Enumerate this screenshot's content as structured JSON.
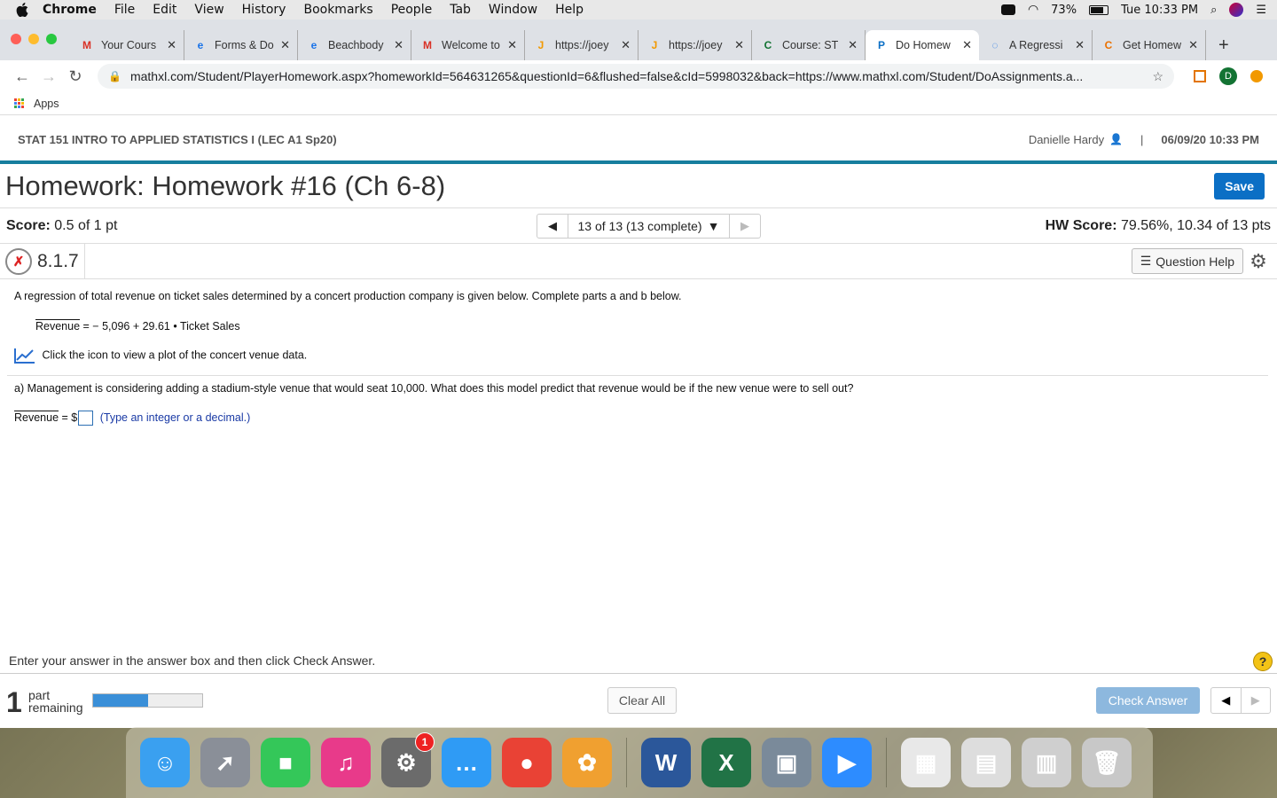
{
  "menubar": {
    "app": "Chrome",
    "items": [
      "File",
      "Edit",
      "View",
      "History",
      "Bookmarks",
      "People",
      "Tab",
      "Window",
      "Help"
    ],
    "battery": "73%",
    "clock": "Tue 10:33 PM"
  },
  "tabs": [
    {
      "title": "Your Cours",
      "icon": "gmail-icon",
      "color": "#d93025",
      "glyph": "M"
    },
    {
      "title": "Forms & Do",
      "icon": "edge-icon",
      "color": "#1a73e8",
      "glyph": "e"
    },
    {
      "title": "Beachbody",
      "icon": "edge-icon",
      "color": "#1a73e8",
      "glyph": "e"
    },
    {
      "title": "Welcome to",
      "icon": "gmail-icon",
      "color": "#d93025",
      "glyph": "M"
    },
    {
      "title": "https://joey",
      "icon": "joey-icon",
      "color": "#f29900",
      "glyph": "J"
    },
    {
      "title": "https://joey",
      "icon": "joey-icon",
      "color": "#f29900",
      "glyph": "J"
    },
    {
      "title": "Course: ST",
      "icon": "course-icon",
      "color": "#137333",
      "glyph": "C"
    },
    {
      "title": "Do Homew",
      "icon": "pearson-icon",
      "color": "#0b6fc5",
      "glyph": "P",
      "active": true
    },
    {
      "title": "A Regressi",
      "icon": "loading-icon",
      "color": "#1a73e8",
      "glyph": "◌"
    },
    {
      "title": "Get Homew",
      "icon": "chegg-icon",
      "color": "#eb7100",
      "glyph": "C"
    }
  ],
  "toolbar": {
    "url": "mathxl.com/Student/PlayerHomework.aspx?homeworkId=564631265&questionId=6&flushed=false&cId=5998032&back=https://www.mathxl.com/Student/DoAssignments.a...",
    "profile_initial": "D"
  },
  "bookmarks": {
    "apps_label": "Apps"
  },
  "course": {
    "title": "STAT 151 INTRO TO APPLIED STATISTICS I (LEC A1 Sp20)",
    "user": "Danielle Hardy",
    "separator": "|",
    "datetime": "06/09/20 10:33 PM"
  },
  "homework": {
    "title": "Homework: Homework #16 (Ch 6-8)",
    "save_label": "Save"
  },
  "score": {
    "label": "Score:",
    "value": "0.5 of 1 pt",
    "nav_text": "13 of 13 (13 complete)",
    "hw_label": "HW Score:",
    "hw_value": "79.56%, 10.34 of 13 pts"
  },
  "question": {
    "status_glyph": "✗",
    "number": "8.1.7",
    "help_label": "Question Help",
    "intro": "A regression of total revenue on ticket sales determined by a concert production company is given below. Complete parts a and b below.",
    "eq_lhs": "Revenue",
    "eq_rhs": "=  − 5,096 + 29.61 • Ticket Sales",
    "plot_link": "Click the icon to view a plot of the concert venue data.",
    "part_a": "a) Management is considering adding a stadium-style venue that would seat 10,000. What does this model predict that revenue would be if the new venue were to sell out?",
    "answer_lhs": "Revenue",
    "answer_eq": "= $",
    "answer_hint": "(Type an integer or a decimal.)"
  },
  "footer": {
    "instructions": "Enter your answer in the answer box and then click Check Answer.",
    "help_glyph": "?",
    "parts_num": "1",
    "parts_word1": "part",
    "parts_word2": "remaining",
    "progress": 0.5,
    "clear_label": "Clear All",
    "check_label": "Check Answer"
  },
  "dock": {
    "apps": [
      {
        "name": "finder-icon",
        "color": "#3aa0f0",
        "glyph": "☺"
      },
      {
        "name": "launchpad-icon",
        "color": "#8a8f98",
        "glyph": "➚"
      },
      {
        "name": "facetime-icon",
        "color": "#34c759",
        "glyph": "■"
      },
      {
        "name": "music-icon",
        "color": "#e83a8a",
        "glyph": "♫"
      },
      {
        "name": "system-preferences-icon",
        "color": "#6b6b6b",
        "glyph": "⚙",
        "badge": "1"
      },
      {
        "name": "messages-icon",
        "color": "#2f9bf5",
        "glyph": "…"
      },
      {
        "name": "chrome-icon",
        "color": "#e94235",
        "glyph": "●"
      },
      {
        "name": "photos-icon",
        "color": "#f0a030",
        "glyph": "✿"
      },
      {
        "sep": true
      },
      {
        "name": "word-icon",
        "color": "#2b579a",
        "glyph": "W"
      },
      {
        "name": "excel-icon",
        "color": "#217346",
        "glyph": "X"
      },
      {
        "name": "preview-icon",
        "color": "#7a8a9a",
        "glyph": "▣"
      },
      {
        "name": "zoom-icon",
        "color": "#2d8cff",
        "glyph": "▶"
      },
      {
        "sep": true
      },
      {
        "name": "excel-window-thumb-icon",
        "color": "#e8e8e8",
        "glyph": "▦"
      },
      {
        "name": "preview-window-thumb-icon",
        "color": "#dddddd",
        "glyph": "▤"
      },
      {
        "name": "chrome-window-thumb-icon",
        "color": "#cfcfcf",
        "glyph": "▥"
      },
      {
        "name": "trash-icon",
        "color": "#c8c8c8",
        "glyph": "🗑"
      }
    ]
  }
}
